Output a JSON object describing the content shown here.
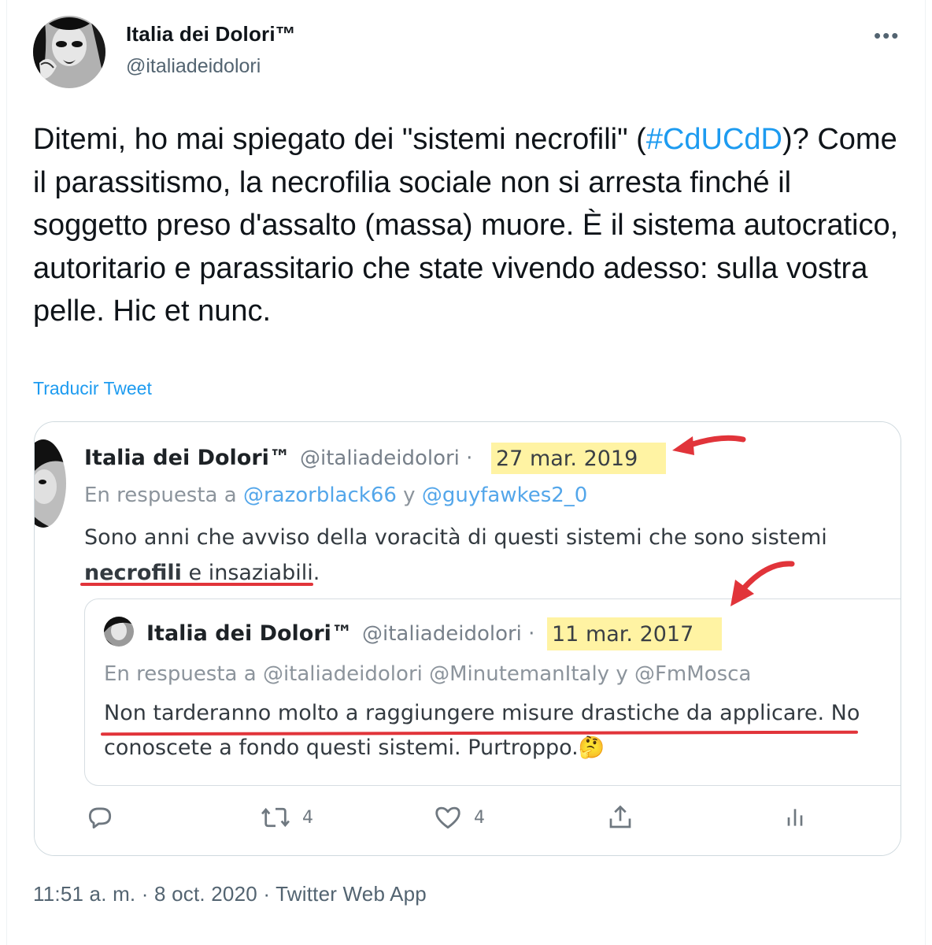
{
  "tweet": {
    "display_name": "Italia dei Dolori™",
    "handle": "@italiadeidolori",
    "more_label": "•••",
    "body_prefix": "Ditemi, ho mai spiegato dei \"sistemi necrofili\" (",
    "hashtag": "#CdUCdD",
    "body_suffix": ")? Come il parassitismo, la necrofilia sociale non si arresta finché il soggetto preso d'assalto (massa) muore. È il sistema autocratico, autoritario e parassitario che state vivendo adesso: sulla vostra pelle. Hic et nunc.",
    "translate_label": "Traducir Tweet",
    "meta": "11:51 a. m. · 8 oct. 2020 · Twitter Web App"
  },
  "screenshot": {
    "name": "Italia dei Dolori™",
    "handle": "@italiadeidolori ·",
    "date": "27 mar. 2019",
    "reply_prefix": "En respuesta a ",
    "mention1": "@razorblack66",
    "reply_and": " y ",
    "mention2": "@guyfawkes2_0",
    "text_line1": "Sono anni che avviso della voracità di questi sistemi che sono sistemi",
    "text_bold": "necrofili",
    "text_line2_rest": " e insaziabili.",
    "quote": {
      "name": "Italia dei Dolori™",
      "handle": "@italiadeidolori ·",
      "date": "11 mar. 2017",
      "reply": "En respuesta a @italiadeidolori @MinutemanItaly y @FmMosca",
      "text_line1": "Non tarderanno molto a raggiungere misure drastiche da applicare. No",
      "text_line2": "conoscete a fondo questi sistemi. Purtroppo.🤔"
    },
    "actions": {
      "retweets": "4",
      "likes": "4"
    },
    "icons": [
      "reply-icon",
      "retweet-icon",
      "like-icon",
      "share-icon",
      "analytics-icon"
    ],
    "highlight_color": "#fff3a3",
    "annotation_color": "#e1343a"
  }
}
